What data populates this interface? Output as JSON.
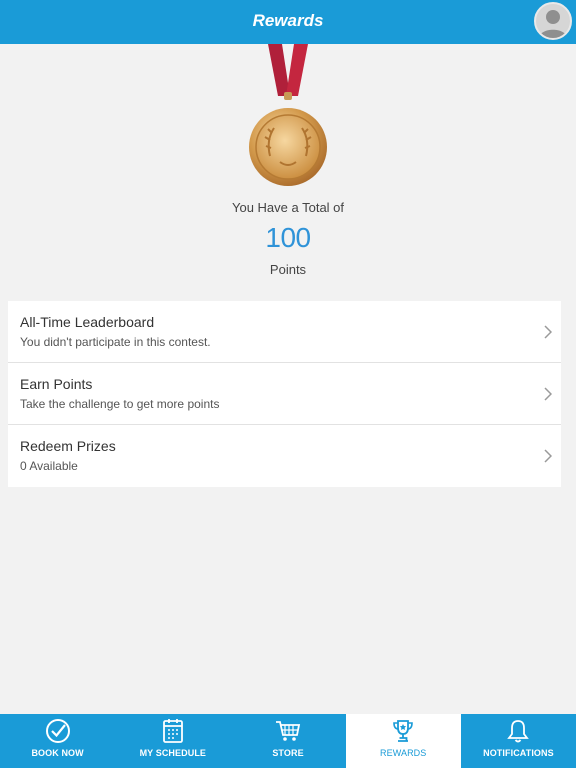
{
  "header": {
    "title": "Rewards"
  },
  "summary": {
    "label_before": "You Have a Total of",
    "points": "100",
    "label_after": "Points"
  },
  "menu": [
    {
      "title": "All-Time Leaderboard",
      "subtitle": "You didn't participate in this contest."
    },
    {
      "title": "Earn Points",
      "subtitle": "Take the challenge to get more points"
    },
    {
      "title": "Redeem Prizes",
      "subtitle": "0 Available"
    }
  ],
  "tabs": [
    {
      "label": "BOOK NOW",
      "icon": "check-circle-icon"
    },
    {
      "label": "MY SCHEDULE",
      "icon": "calendar-icon"
    },
    {
      "label": "STORE",
      "icon": "cart-icon"
    },
    {
      "label": "REWARDS",
      "icon": "trophy-icon",
      "active": true
    },
    {
      "label": "NOTIFICATIONS",
      "icon": "bell-icon"
    }
  ],
  "colors": {
    "accent": "#1a9bd7",
    "points": "#2f93d8",
    "ribbon": "#b0203a",
    "medal": "#c98a3a"
  }
}
